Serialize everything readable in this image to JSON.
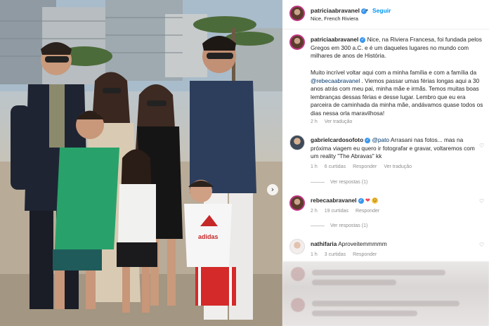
{
  "header": {
    "username": "patriciaabravanel",
    "separator": "•",
    "follow_label": "Seguir",
    "location": "Nice, French Riviera",
    "more_label": "···"
  },
  "caption": {
    "username": "patriciaabravanel",
    "part1": "Nice, na Riviera Francesa, foi fundada pelos Gregos em 300 a.C. e é um daqueles lugares no mundo com milhares de anos de História.",
    "part2_before": "Muito incrível voltar aqui com a minha família e com a família da ",
    "mention": "@rebecaabravanel",
    "part2_after": " . Viemos passar umas férias longas aqui a 30 anos atrás com meu pai, minha mãe e irmãs. Temos muitas boas lembranças dessas férias e desse lugar. Lembro que eu era parceira de caminhada da minha mãe, andávamos quase todos os dias nessa orla maravilhosa!",
    "time": "2 h",
    "translate": "Ver tradução"
  },
  "comments": [
    {
      "username": "gabrielcardosofoto",
      "verified": true,
      "mention": "@pato",
      "text": " Arrasani nas fotos... mas na próxima viagem eu quero ir fotografar e gravar, voltaremos com um reality \"The Abravas\" kk",
      "time": "1 h",
      "likes": "6 curtidas",
      "reply": "Responder",
      "translate": "Ver tradução",
      "view_replies": "Ver respostas (1)"
    },
    {
      "username": "rebecaabravanel",
      "verified": true,
      "emoji_heart": "❤",
      "emoji_smile": "☺",
      "time": "2 h",
      "likes": "19 curtidas",
      "reply": "Responder",
      "view_replies": "Ver respostas (1)"
    },
    {
      "username": "nathifaria",
      "verified": false,
      "text": "Aproveitemmmmm",
      "time": "1 h",
      "likes": "3 curtidas",
      "reply": "Responder"
    }
  ],
  "photo": {
    "next_glyph": "›",
    "shirt_text": "adidas"
  },
  "colors": {
    "accent": "#0095f6",
    "verified": "#3897f0",
    "text": "#262626",
    "meta": "#8e8e8e",
    "mention": "#00376b"
  }
}
